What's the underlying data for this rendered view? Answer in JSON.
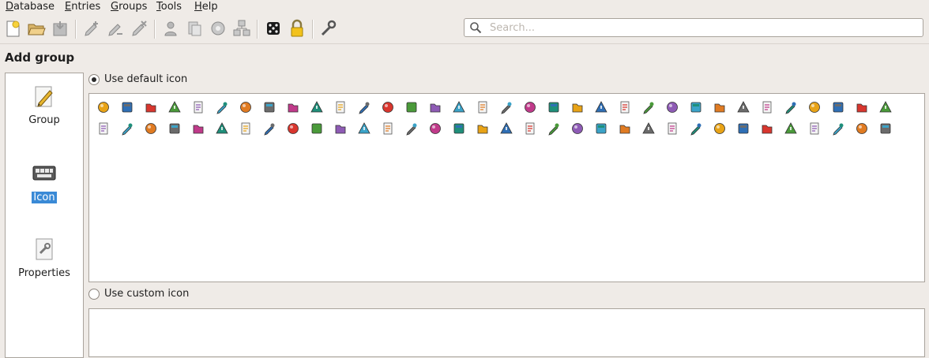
{
  "menu": [
    "Database",
    "Entries",
    "Groups",
    "Tools",
    "Help"
  ],
  "toolbar": {
    "buttons": [
      "new-database-icon",
      "open-database-icon",
      "save-database-icon",
      "add-entry-icon",
      "edit-entry-icon",
      "delete-entry-icon",
      "copy-username-icon",
      "copy-password-icon",
      "autotype-icon",
      "add-group-icon",
      "password-generator-icon",
      "lock-database-icon",
      "settings-wrench-icon"
    ],
    "search_placeholder": "Search..."
  },
  "page_title": "Add group",
  "categories": [
    {
      "label": "Group",
      "icon": "pencil-note-icon",
      "selected": false
    },
    {
      "label": "Icon",
      "icon": "keyboard-icon",
      "selected": true
    },
    {
      "label": "Properties",
      "icon": "properties-icon",
      "selected": false
    }
  ],
  "default_icon": {
    "label": "Use default icon",
    "checked": true
  },
  "custom_icon": {
    "label": "Use custom icon",
    "checked": false
  },
  "icon_grid": {
    "count": 69,
    "per_row": 34,
    "names": [
      "key-icon",
      "globe-icon",
      "warning-icon",
      "server-icon",
      "pinned-note-icon",
      "users-icon",
      "blocks-icon",
      "notepad-icon",
      "globe-plug-icon",
      "id-card-icon",
      "note-scroll-icon",
      "camera-icon",
      "wireless-icon",
      "keyring-icon",
      "plug-icon",
      "scanner-icon",
      "world-star-icon",
      "cd-icon",
      "monitor-icon",
      "email-icon",
      "gear-icon",
      "clipboard-icon",
      "paper-icon",
      "screen-icon",
      "lightning-icon",
      "mailbox-icon",
      "floppy-icon",
      "disk-icon",
      "film-icon",
      "terminal-icon",
      "printer-icon",
      "grid-icon",
      "checkerboard-icon",
      "wrench-icon",
      "computer-icon",
      "archive-icon",
      "percent-icon",
      "windows-icon",
      "clock-icon",
      "search-icon",
      "image-icon",
      "memory-icon",
      "trash-icon",
      "sticky-note-icon",
      "cross-icon",
      "help-icon",
      "package-icon",
      "folder-icon",
      "folder-open-icon",
      "folder-db-icon",
      "lock-open-icon",
      "lock-closed-icon",
      "check-icon",
      "pen-icon",
      "photo-icon",
      "book-icon",
      "list-icon",
      "user-key-icon",
      "hammer-icon",
      "home-icon",
      "star-icon",
      "tux-icon",
      "feather-icon",
      "apple-icon",
      "wikipedia-icon",
      "dollar-icon",
      "certificate-icon",
      "phone-icon"
    ]
  }
}
